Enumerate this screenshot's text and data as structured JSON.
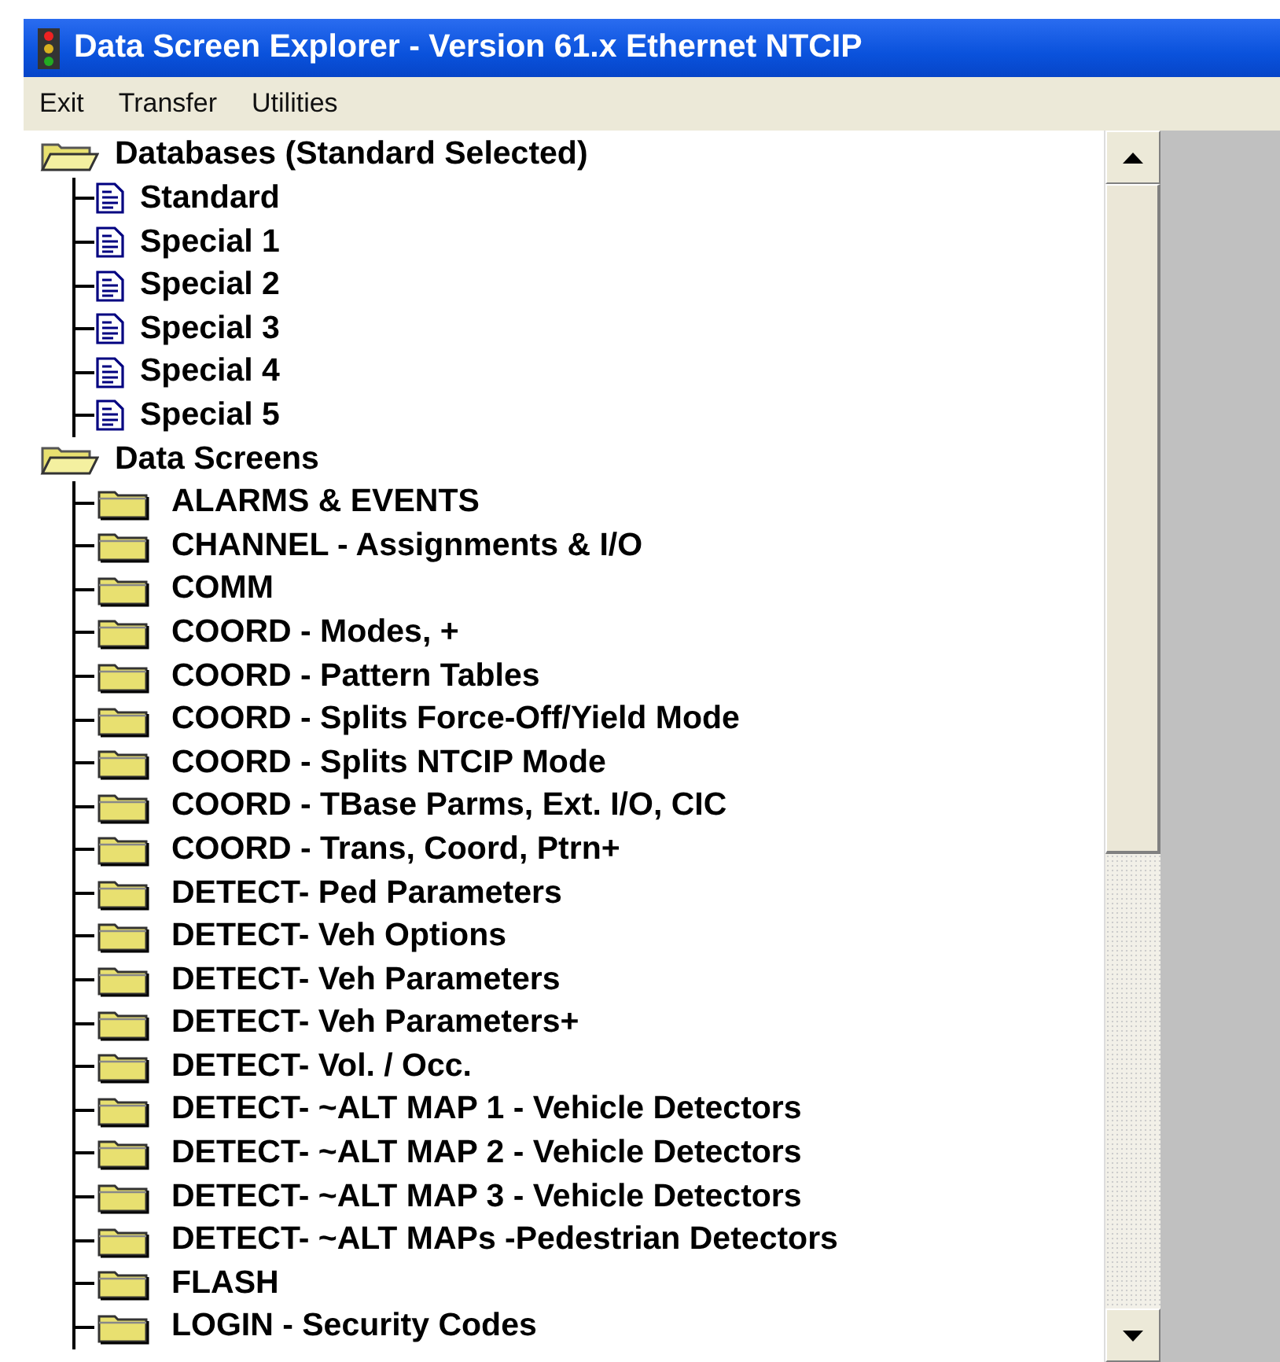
{
  "window": {
    "title": "Data Screen Explorer - Version 61.x Ethernet NTCIP"
  },
  "menu": [
    "Exit",
    "Transfer",
    "Utilities"
  ],
  "tree": [
    {
      "label": "Databases (Standard Selected)",
      "kind": "folder",
      "expanded": true,
      "children": [
        {
          "label": "Standard",
          "kind": "document"
        },
        {
          "label": "Special 1",
          "kind": "document"
        },
        {
          "label": "Special 2",
          "kind": "document"
        },
        {
          "label": "Special 3",
          "kind": "document"
        },
        {
          "label": "Special 4",
          "kind": "document"
        },
        {
          "label": "Special 5",
          "kind": "document"
        }
      ]
    },
    {
      "label": "Data Screens",
      "kind": "folder",
      "expanded": true,
      "children": [
        {
          "label": "ALARMS & EVENTS",
          "kind": "folder",
          "expanded": false
        },
        {
          "label": "CHANNEL - Assignments & I/O",
          "kind": "folder",
          "expanded": false
        },
        {
          "label": "COMM",
          "kind": "folder",
          "expanded": false
        },
        {
          "label": "COORD - Modes, +",
          "kind": "folder",
          "expanded": false
        },
        {
          "label": "COORD - Pattern Tables",
          "kind": "folder",
          "expanded": false
        },
        {
          "label": "COORD - Splits Force-Off/Yield Mode",
          "kind": "folder",
          "expanded": false
        },
        {
          "label": "COORD - Splits NTCIP Mode",
          "kind": "folder",
          "expanded": false
        },
        {
          "label": "COORD - TBase Parms, Ext. I/O, CIC",
          "kind": "folder",
          "expanded": false
        },
        {
          "label": "COORD - Trans, Coord, Ptrn+",
          "kind": "folder",
          "expanded": false
        },
        {
          "label": "DETECT- Ped Parameters",
          "kind": "folder",
          "expanded": false
        },
        {
          "label": "DETECT- Veh Options",
          "kind": "folder",
          "expanded": false
        },
        {
          "label": "DETECT- Veh Parameters",
          "kind": "folder",
          "expanded": false
        },
        {
          "label": "DETECT- Veh Parameters+",
          "kind": "folder",
          "expanded": false
        },
        {
          "label": "DETECT- Vol. / Occ.",
          "kind": "folder",
          "expanded": false
        },
        {
          "label": "DETECT- ~ALT MAP 1 - Vehicle Detectors",
          "kind": "folder",
          "expanded": false
        },
        {
          "label": "DETECT- ~ALT MAP 2 - Vehicle Detectors",
          "kind": "folder",
          "expanded": false
        },
        {
          "label": "DETECT- ~ALT MAP 3 - Vehicle Detectors",
          "kind": "folder",
          "expanded": false
        },
        {
          "label": "DETECT- ~ALT MAPs -Pedestrian Detectors",
          "kind": "folder",
          "expanded": false
        },
        {
          "label": "FLASH",
          "kind": "folder",
          "expanded": false
        },
        {
          "label": "LOGIN - Security Codes",
          "kind": "folder",
          "expanded": false
        }
      ]
    }
  ]
}
